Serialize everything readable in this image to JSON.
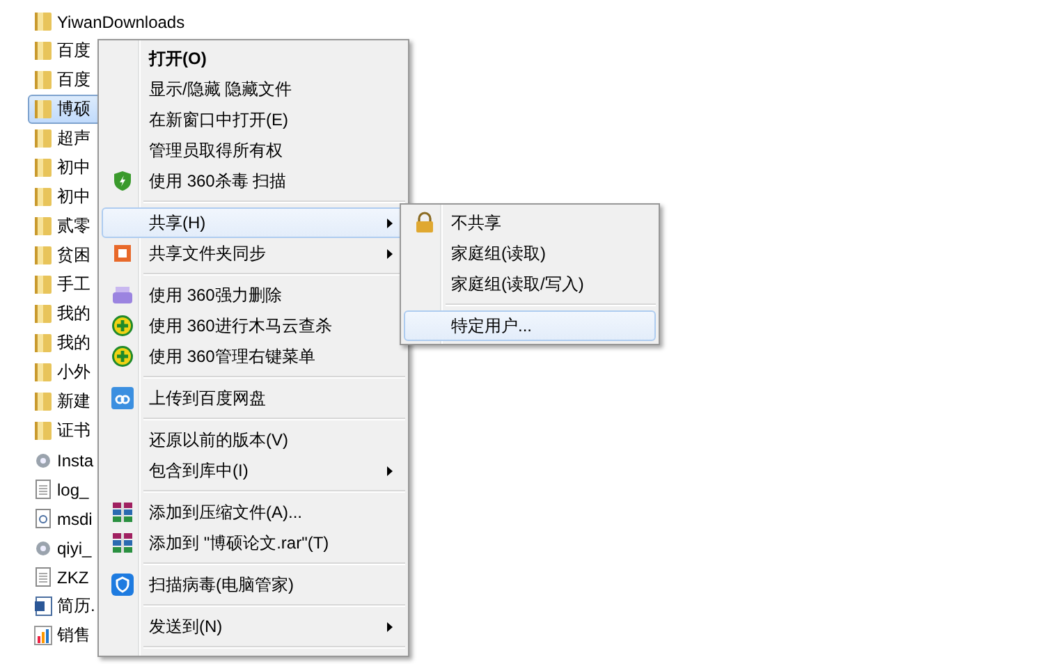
{
  "files": [
    {
      "name": "YiwanDownloads",
      "kind": "folder",
      "selected": false
    },
    {
      "name": "百度",
      "kind": "folder",
      "selected": false
    },
    {
      "name": "百度",
      "kind": "folder",
      "selected": false
    },
    {
      "name": "博硕",
      "kind": "folder",
      "selected": true
    },
    {
      "name": "超声",
      "kind": "folder",
      "selected": false
    },
    {
      "name": "初中",
      "kind": "folder",
      "selected": false
    },
    {
      "name": "初中",
      "kind": "folder",
      "selected": false
    },
    {
      "name": "贰零",
      "kind": "folder",
      "selected": false
    },
    {
      "name": "贫困",
      "kind": "folder",
      "selected": false
    },
    {
      "name": "手工",
      "kind": "folder",
      "selected": false
    },
    {
      "name": "我的",
      "kind": "folder",
      "selected": false
    },
    {
      "name": "我的",
      "kind": "folder",
      "selected": false
    },
    {
      "name": "小外",
      "kind": "folder",
      "selected": false
    },
    {
      "name": "新建",
      "kind": "folder",
      "selected": false
    },
    {
      "name": "证书",
      "kind": "folder",
      "selected": false
    },
    {
      "name": "Insta",
      "kind": "setup",
      "selected": false
    },
    {
      "name": "log_",
      "kind": "text",
      "selected": false
    },
    {
      "name": "msdi",
      "kind": "link",
      "selected": false
    },
    {
      "name": "qiyi_",
      "kind": "setup",
      "selected": false
    },
    {
      "name": "ZKZ",
      "kind": "text",
      "selected": false
    },
    {
      "name": "简历.",
      "kind": "word",
      "selected": false
    },
    {
      "name": "销售",
      "kind": "chart",
      "selected": false
    }
  ],
  "context_menu": [
    {
      "kind": "plain",
      "label": "打开(O)",
      "bold": true,
      "selected": false
    },
    {
      "kind": "plain",
      "label": "显示/隐藏 隐藏文件",
      "selected": false
    },
    {
      "kind": "plain",
      "label": "在新窗口中打开(E)",
      "selected": false
    },
    {
      "kind": "plain",
      "label": "管理员取得所有权",
      "selected": false
    },
    {
      "kind": "shield",
      "label": "使用 360杀毒 扫描",
      "selected": false
    },
    {
      "kind": "separator"
    },
    {
      "kind": "plain",
      "label": "共享(H)",
      "submenu": true,
      "selected": true
    },
    {
      "kind": "sync",
      "label": "共享文件夹同步",
      "submenu": true,
      "selected": false
    },
    {
      "kind": "separator"
    },
    {
      "kind": "shredder",
      "label": "使用 360强力删除",
      "selected": false
    },
    {
      "kind": "plus",
      "label": "使用 360进行木马云查杀",
      "selected": false
    },
    {
      "kind": "plus",
      "label": "使用 360管理右键菜单",
      "selected": false
    },
    {
      "kind": "separator"
    },
    {
      "kind": "cloud",
      "label": "上传到百度网盘",
      "selected": false
    },
    {
      "kind": "separator"
    },
    {
      "kind": "plain",
      "label": "还原以前的版本(V)",
      "selected": false
    },
    {
      "kind": "plain",
      "label": "包含到库中(I)",
      "submenu": true,
      "selected": false
    },
    {
      "kind": "separator"
    },
    {
      "kind": "archive",
      "label": "添加到压缩文件(A)...",
      "selected": false
    },
    {
      "kind": "archive",
      "label": "添加到 \"博硕论文.rar\"(T)",
      "selected": false
    },
    {
      "kind": "separator"
    },
    {
      "kind": "guard",
      "label": "扫描病毒(电脑管家)",
      "selected": false
    },
    {
      "kind": "separator"
    },
    {
      "kind": "plain",
      "label": "发送到(N)",
      "submenu": true,
      "selected": false
    },
    {
      "kind": "separator"
    }
  ],
  "share_submenu": [
    {
      "kind": "lock",
      "label": "不共享",
      "selected": false
    },
    {
      "kind": "plain",
      "label": "家庭组(读取)",
      "selected": false
    },
    {
      "kind": "plain",
      "label": "家庭组(读取/写入)",
      "selected": false
    },
    {
      "kind": "separator"
    },
    {
      "kind": "plain",
      "label": "特定用户...",
      "selected": true
    }
  ]
}
